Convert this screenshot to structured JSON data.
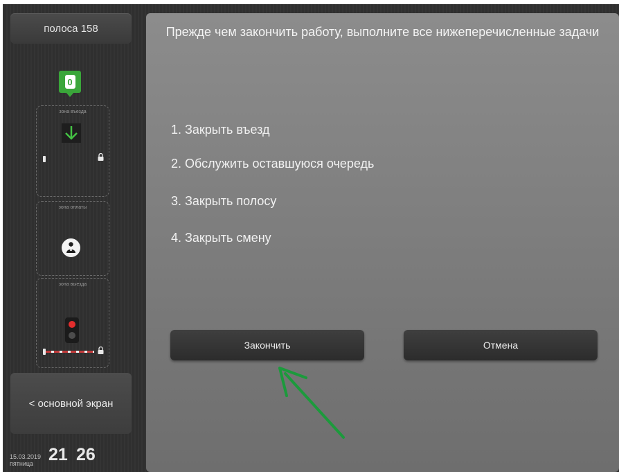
{
  "sidebar": {
    "lane_label": "полоса 158",
    "queue_count": "0",
    "zones": {
      "entry": "зона въезда",
      "payment": "зона оплаты",
      "exit": "зона выезда"
    },
    "back_button": "< основной экран",
    "date": "15.03.2019",
    "weekday": "пятница",
    "hours": "21",
    "minutes": "26"
  },
  "dialog": {
    "title": "Прежде чем закончить работу, выполните все нижеперечисленные задачи",
    "tasks": [
      "1. Закрыть въезд",
      "2. Обслужить оставшуюся очередь",
      "3. Закрыть полосу",
      "4. Закрыть смену"
    ],
    "finish_button": "Закончить",
    "cancel_button": "Отмена"
  },
  "colors": {
    "accent_green": "#3aa63a",
    "signal_red": "#e22d2d",
    "annotation_arrow": "#1c9a3c"
  },
  "icons": [
    "down-arrow-icon",
    "lock-icon",
    "driver-icon",
    "traffic-light-icon",
    "barrier-icon",
    "annotation-arrow"
  ]
}
